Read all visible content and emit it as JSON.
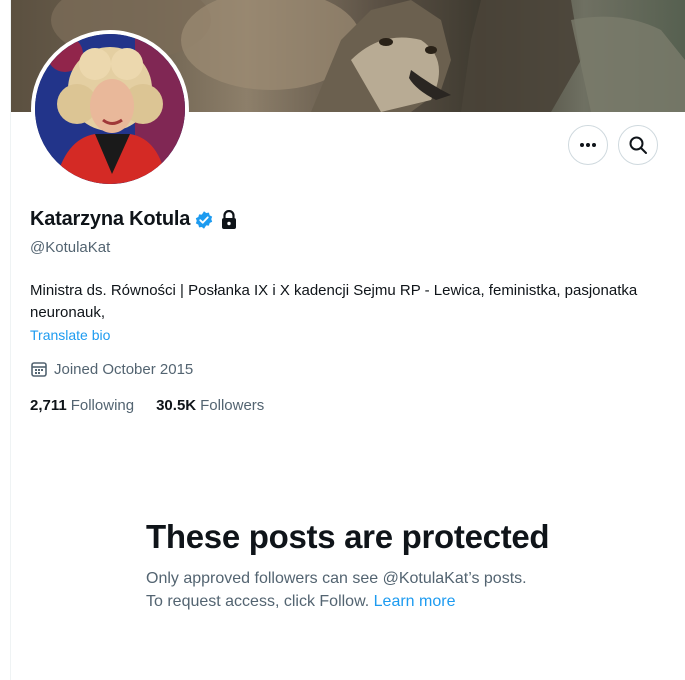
{
  "profile": {
    "display_name": "Katarzyna Kotula",
    "handle": "@KotulaKat",
    "bio": "Ministra ds. Równości | Posłanka IX i X kadencji Sejmu RP - Lewica, feministka, pasjonatka neuronauk,",
    "translate_label": "Translate bio",
    "joined": "Joined October 2015",
    "following_count": "2,711",
    "following_label": "Following",
    "followers_count": "30.5K",
    "followers_label": "Followers"
  },
  "icons": {
    "more": "more-horizontal-icon",
    "search": "search-icon",
    "verified": "verified-badge-icon",
    "lock": "lock-icon",
    "calendar": "calendar-icon"
  },
  "protected_notice": {
    "title": "These posts are protected",
    "body": "Only approved followers can see @KotulaKat’s posts. To request access, click Follow.",
    "link": "Learn more"
  },
  "colors": {
    "accent": "#1d9bf0",
    "text_primary": "#0f1419",
    "text_secondary": "#536471",
    "border": "#cfd9de"
  }
}
